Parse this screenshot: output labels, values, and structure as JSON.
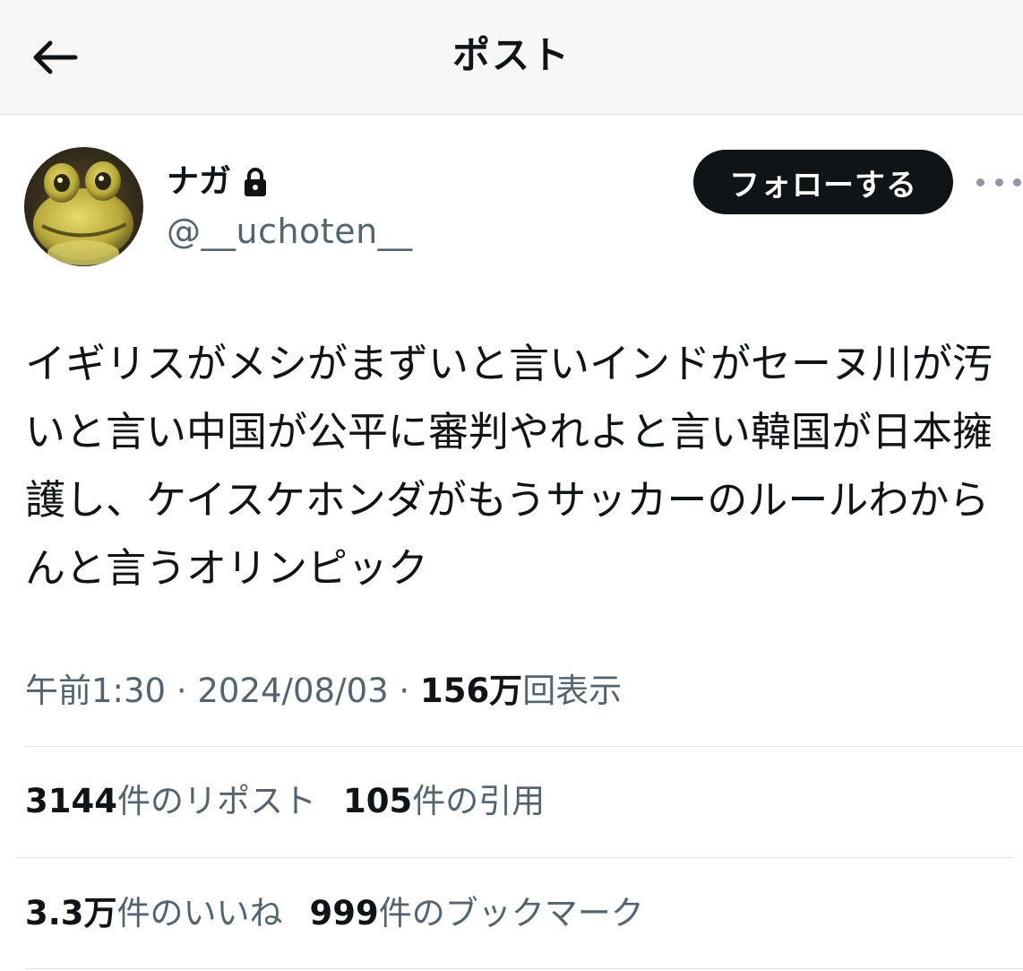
{
  "header": {
    "title": "ポスト",
    "back_icon": "arrow-left-icon"
  },
  "author": {
    "display_name": "ナガ",
    "handle": "@__uchoten__",
    "protected_icon": "lock-icon",
    "avatar": "frog-avatar"
  },
  "follow_button": {
    "label": "フォローする"
  },
  "more_icon": "more-dots-icon",
  "post": {
    "text": "イギリスがメシがまずいと言いインドがセーヌ川が汚いと言い中国が公平に審判やれよと言い韓国が日本擁護し、ケイスケホンダがもうサッカーのルールわからんと言うオリンピック"
  },
  "meta": {
    "time": "午前1:30",
    "separator": "·",
    "date": "2024/08/03",
    "views_count": "156万",
    "views_label": "回表示"
  },
  "stats": {
    "reposts_count": "3144",
    "reposts_label": "件のリポスト",
    "quotes_count": "105",
    "quotes_label": "件の引用",
    "likes_count": "3.3万",
    "likes_label": "件のいいね",
    "bookmarks_count": "999",
    "bookmarks_label": "件のブックマーク"
  },
  "colors": {
    "text_primary": "#0f1419",
    "text_secondary": "#536471",
    "button_bg": "#0f1419",
    "divider": "#e1e1e1"
  }
}
